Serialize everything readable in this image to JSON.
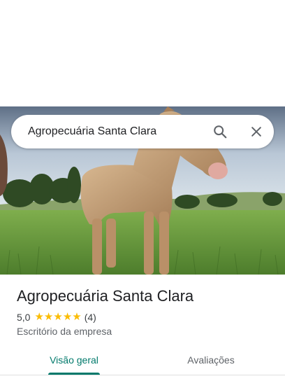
{
  "search": {
    "query": "Agropecuária Santa Clara"
  },
  "place": {
    "name": "Agropecuária Santa Clara",
    "rating": "5,0",
    "stars": 5,
    "review_count": "(4)",
    "category": "Escritório da empresa"
  },
  "tabs": [
    {
      "label": "Visão geral",
      "active": true
    },
    {
      "label": "Avaliações",
      "active": false
    }
  ],
  "colors": {
    "accent": "#00796b",
    "star": "#fbbc04"
  },
  "icons": {
    "search": "search-icon",
    "close": "close-icon"
  }
}
